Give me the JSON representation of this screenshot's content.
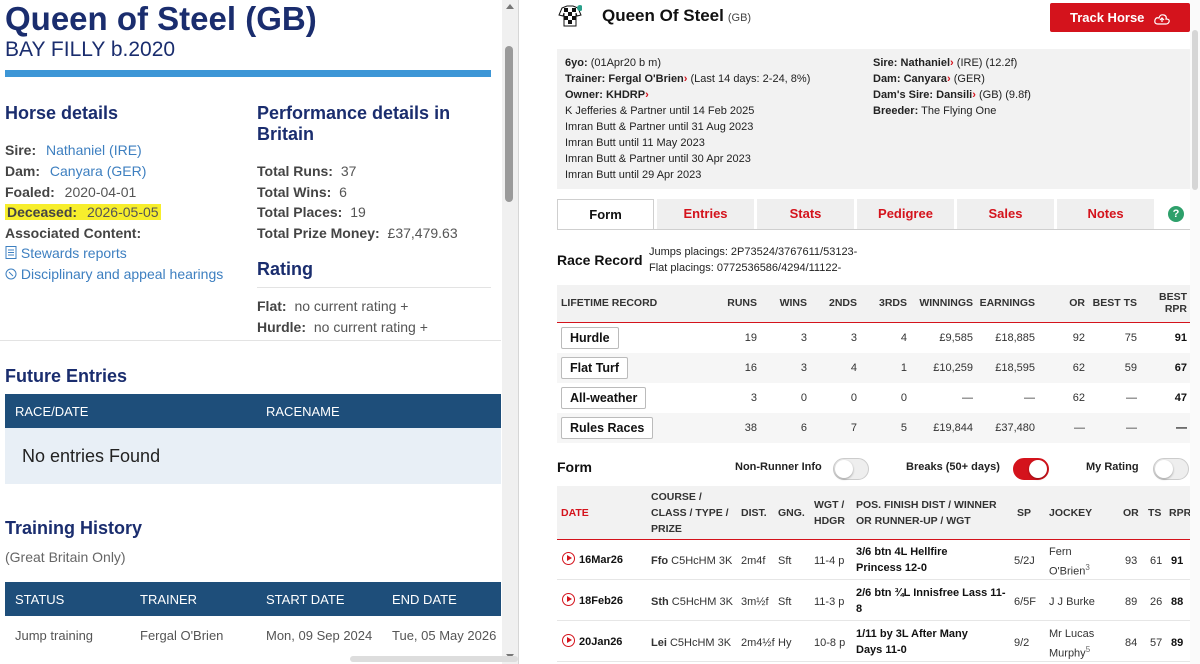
{
  "left": {
    "title": "Queen of Steel (GB)",
    "subtitle": "BAY FILLY b.2020",
    "horse_details": {
      "heading": "Horse details",
      "sire_label": "Sire:",
      "sire": "Nathaniel (IRE)",
      "dam_label": "Dam:",
      "dam": "Canyara (GER)",
      "foaled_label": "Foaled:",
      "foaled": "2020-04-01",
      "deceased_label": "Deceased:",
      "deceased": "2026-05-05",
      "associated_label": "Associated Content:",
      "stewards_link": "Stewards reports",
      "disciplinary_link": "Disciplinary and appeal hearings"
    },
    "performance": {
      "heading": "Performance details in Britain",
      "runs_label": "Total Runs:",
      "runs": "37",
      "wins_label": "Total Wins:",
      "wins": "6",
      "places_label": "Total Places:",
      "places": "19",
      "prize_label": "Total Prize Money:",
      "prize": "£37,479.63"
    },
    "rating": {
      "heading": "Rating",
      "flat_label": "Flat:",
      "flat": "no current rating +",
      "hurdle_label": "Hurdle:",
      "hurdle": "no current rating +"
    },
    "future_entries": {
      "heading": "Future Entries",
      "col_race": "RACE/DATE",
      "col_name": "RACENAME",
      "empty": "No entries Found"
    },
    "training": {
      "heading": "Training History",
      "sub": "(Great Britain Only)",
      "cols": [
        "STATUS",
        "TRAINER",
        "START DATE",
        "END DATE"
      ],
      "rows": [
        [
          "Jump training",
          "Fergal O'Brien",
          "Mon, 09 Sep 2024",
          "Tue, 05 May 2026"
        ]
      ]
    }
  },
  "right": {
    "name": "Queen Of Steel",
    "country": "(GB)",
    "track_button": "Track Horse",
    "info_left": {
      "age": "6yo:",
      "age_detail": "(01Apr20 b m)",
      "trainer_label": "Trainer:",
      "trainer": "Fergal O'Brien",
      "trainer_detail": "(Last 14 days: 2-24, 8%)",
      "owner_label": "Owner:",
      "owner": "KHDRP",
      "history": [
        "K Jefferies & Partner until 14 Feb 2025",
        "Imran Butt & Partner until 31 Aug 2023",
        "Imran Butt until 11 May 2023",
        "Imran Butt & Partner until 30 Apr 2023",
        "Imran Butt until 29 Apr 2023"
      ]
    },
    "info_right": {
      "sire_label": "Sire:",
      "sire": "Nathaniel",
      "sire_detail": "(IRE) (12.2f)",
      "dam_label": "Dam:",
      "dam": "Canyara",
      "dam_detail": "(GER)",
      "damsire_label": "Dam's Sire:",
      "damsire": "Dansili",
      "damsire_detail": "(GB) (9.8f)",
      "breeder_label": "Breeder:",
      "breeder": "The Flying One"
    },
    "tabs": [
      "Form",
      "Entries",
      "Stats",
      "Pedigree",
      "Sales",
      "Notes"
    ],
    "help": "?",
    "race_record": {
      "heading": "Race Record",
      "jumps": "Jumps placings: 2P73524/3767611/53123-",
      "flat": "Flat placings: 0772536586/4294/11122-"
    },
    "lifetime": {
      "cols": [
        "LIFETIME RECORD",
        "RUNS",
        "WINS",
        "2NDS",
        "3RDS",
        "WINNINGS",
        "EARNINGS",
        "OR",
        "BEST TS",
        "BEST",
        "RPR"
      ],
      "rows": [
        {
          "label": "Hurdle",
          "vals": [
            "19",
            "3",
            "3",
            "4",
            "£9,585",
            "£18,885",
            "92",
            "75",
            "91"
          ]
        },
        {
          "label": "Flat Turf",
          "vals": [
            "16",
            "3",
            "4",
            "1",
            "£10,259",
            "£18,595",
            "62",
            "59",
            "67"
          ]
        },
        {
          "label": "All-weather",
          "vals": [
            "3",
            "0",
            "0",
            "0",
            "—",
            "—",
            "62",
            "—",
            "47"
          ]
        },
        {
          "label": "Rules Races",
          "vals": [
            "38",
            "6",
            "7",
            "5",
            "£19,844",
            "£37,480",
            "—",
            "—",
            "—"
          ]
        }
      ]
    },
    "form": {
      "heading": "Form",
      "toggle_nonrunner": "Non-Runner Info",
      "toggle_breaks": "Breaks (50+ days)",
      "toggle_myrating": "My Rating",
      "cols": {
        "date": "DATE",
        "course": "COURSE /",
        "course2": "CLASS / TYPE /",
        "course3": "PRIZE",
        "dist": "DIST.",
        "gng": "GNG.",
        "wgt": "WGT /",
        "wgt2": "HDGR",
        "pos": "POS. FINISH DIST / WINNER",
        "pos2": "OR RUNNER-UP / WGT",
        "sp": "SP",
        "jockey": "JOCKEY",
        "or": "OR",
        "ts": "TS",
        "rpr": "RPR"
      },
      "rows": [
        {
          "date": "16Mar26",
          "course": "Ffo",
          "cls": "C5HcHM 3K",
          "dist": "2m4f",
          "gng": "Sft",
          "wgt": "11-4 p",
          "pos1": "3/6 btn 4L Hellfire",
          "pos2": "Princess 12-0",
          "sp": "5/2J",
          "jockey1": "Fern",
          "jockey2": "O'Brien",
          "jsup": "3",
          "or": "93",
          "ts": "61",
          "rpr": "91"
        },
        {
          "date": "18Feb26",
          "course": "Sth",
          "cls": "C5HcHM 3K",
          "dist": "3m½f",
          "gng": "Sft",
          "wgt": "11-3 p",
          "pos1": "2/6 btn ¾L Innisfree Lass 11-",
          "pos2": "8",
          "sp": "6/5F",
          "jockey1": "J J Burke",
          "jockey2": "",
          "jsup": "",
          "or": "89",
          "ts": "26",
          "rpr": "88"
        },
        {
          "date": "20Jan26",
          "course": "Lei",
          "cls": "C5HcHM 3K",
          "dist": "2m4½f",
          "gng": "Hy",
          "wgt": "10-8 p",
          "pos1": "1/11 by 3L After Many",
          "pos2": "Days 11-0",
          "sp": "9/2",
          "jockey1": "Mr Lucas",
          "jockey2": "Murphy",
          "jsup": "5",
          "or": "84",
          "ts": "57",
          "rpr": "89"
        }
      ]
    }
  }
}
